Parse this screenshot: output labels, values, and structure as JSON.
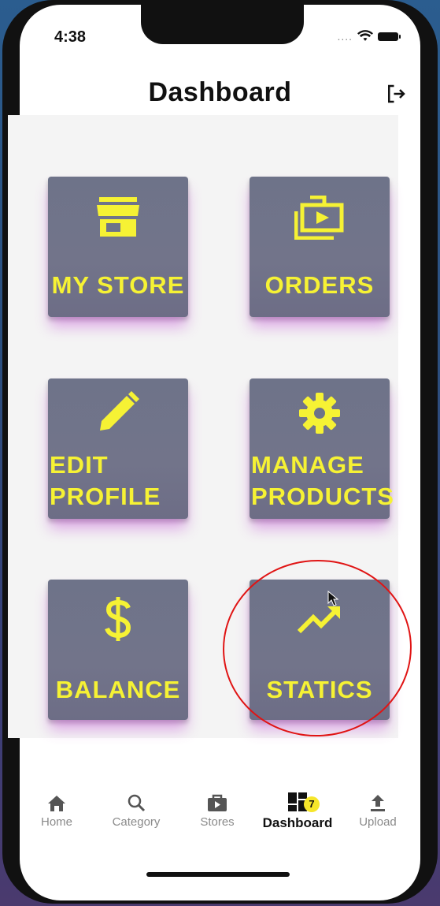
{
  "status_bar": {
    "time": "4:38",
    "signal_dots": "....",
    "wifi_icon": "wifi-icon",
    "battery_icon": "battery-icon"
  },
  "app_bar": {
    "title": "Dashboard",
    "logout_icon": "logout-icon"
  },
  "tiles": [
    {
      "label": "MY STORE",
      "icon": "storefront-icon"
    },
    {
      "label": "ORDERS",
      "icon": "shop-two-icon"
    },
    {
      "label": "EDIT\nPROFILE",
      "icon": "edit-pencil-icon"
    },
    {
      "label": "MANAGE\nPRODUCTS",
      "icon": "settings-gear-icon"
    },
    {
      "label": "BALANCE",
      "icon": "dollar-icon"
    },
    {
      "label": "STATICS",
      "icon": "trending-up-icon"
    }
  ],
  "colors": {
    "tile_label": "#f6f234",
    "tile_bg": "#6e7389",
    "annotation": "#e01414",
    "badge": "#f6e62a"
  },
  "tabs": [
    {
      "label": "Home",
      "icon": "home-icon"
    },
    {
      "label": "Category",
      "icon": "search-icon"
    },
    {
      "label": "Stores",
      "icon": "shop-icon"
    },
    {
      "label": "Dashboard",
      "icon": "dashboard-icon",
      "active": true,
      "badge": "7"
    },
    {
      "label": "Upload",
      "icon": "upload-icon"
    }
  ]
}
